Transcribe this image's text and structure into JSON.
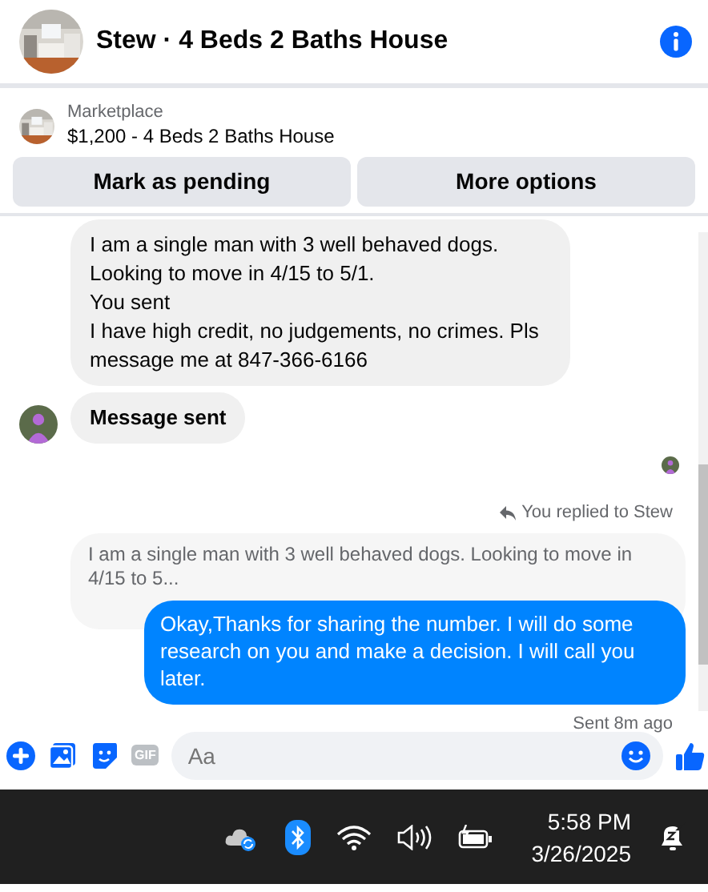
{
  "header": {
    "title": "Stew · 4 Beds 2 Baths House"
  },
  "listing": {
    "source": "Marketplace",
    "title": "$1,200 - 4 Beds 2 Baths House"
  },
  "actions": [
    "Mark as pending",
    "More options"
  ],
  "incoming": [
    {
      "lines": [
        "I am a single man with 3 well behaved dogs.",
        "Looking to move in 4/15 to 5/1.",
        "You sent",
        "I have high credit, no judgements, no crimes. Pls message me at 847-366-6166"
      ]
    },
    {
      "lines": [
        "Message sent"
      ]
    }
  ],
  "reply": {
    "label": "You replied to Stew",
    "quote": "I am a single man with 3 well behaved dogs. Looking to move in 4/15 to 5..."
  },
  "outgoing": {
    "text": "Okay,Thanks for sharing the number. I will do some research on you and make a decision. I will call you later.",
    "status": "Sent 8m ago"
  },
  "composer": {
    "placeholder": "Aa",
    "gif": "GIF"
  },
  "taskbar": {
    "time": "5:58 PM",
    "date": "3/26/2025"
  }
}
